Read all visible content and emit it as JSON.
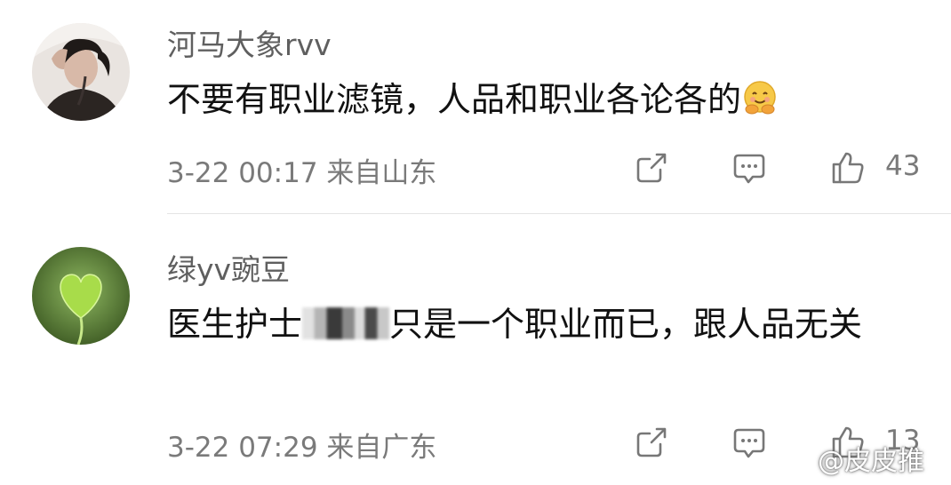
{
  "comments": [
    {
      "username": "河马大象rvv",
      "text": "不要有职业滤镜，人品和职业各论各的",
      "emoji": "hugging-face-emoji",
      "date_location": "3-22 00:17 来自山东",
      "likes": "43",
      "avatar": "person-avatar"
    },
    {
      "username": "绿yv豌豆",
      "text_before": "医生护士",
      "text_after": "只是一个职业而已，跟人品无关",
      "redaction": "mosaic-blur",
      "date_location": "3-22 07:29 来自广东",
      "likes": "13",
      "avatar": "clover-leaf-avatar"
    }
  ],
  "icons": {
    "share": "share-icon",
    "comment": "comment-icon",
    "like": "like-icon"
  },
  "watermark": {
    "text": "@皮皮推",
    "icon": "weibo-icon"
  },
  "colors": {
    "meta": "#7a7a7a",
    "username": "#5f5f5f",
    "text": "#111111",
    "divider": "#e4e4e4"
  }
}
